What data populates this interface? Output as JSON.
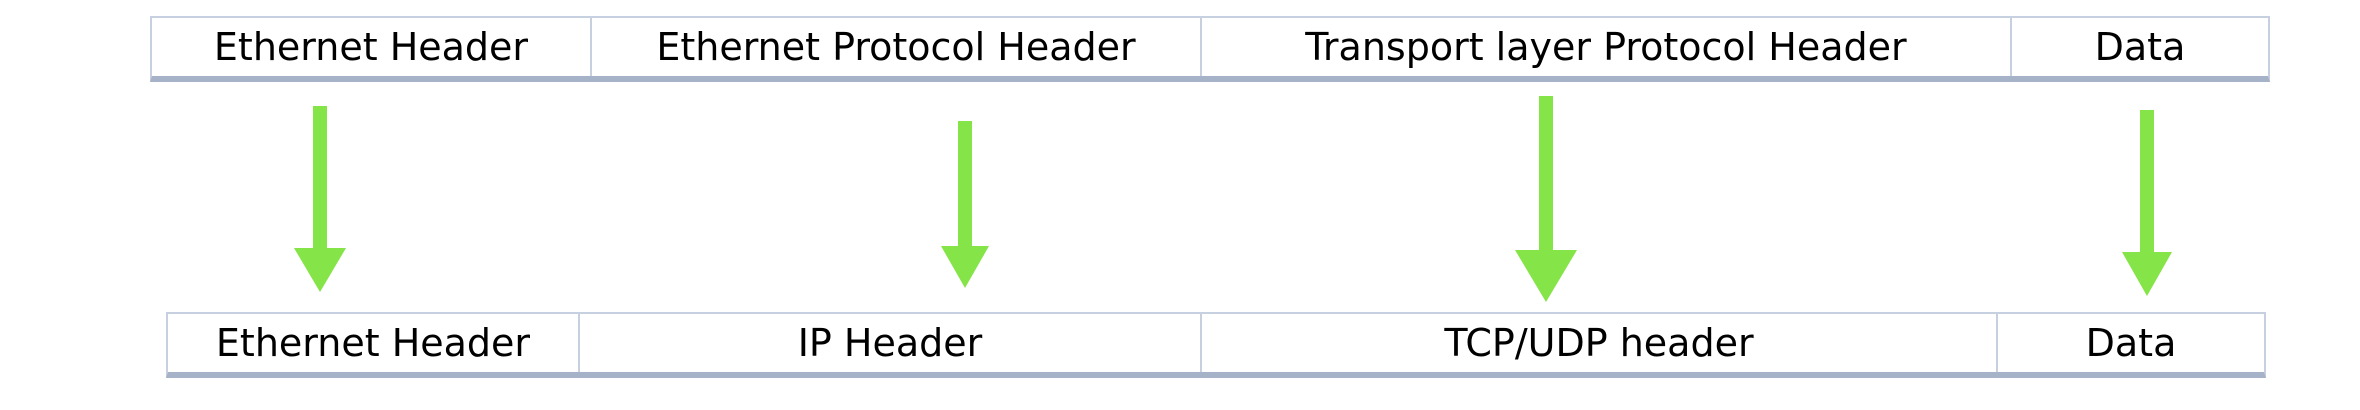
{
  "top_row": {
    "cells": [
      {
        "label": "Ethernet Header"
      },
      {
        "label": "Ethernet Protocol Header"
      },
      {
        "label": "Transport layer Protocol Header"
      },
      {
        "label": "Data"
      }
    ]
  },
  "bottom_row": {
    "cells": [
      {
        "label": "Ethernet Header"
      },
      {
        "label": "IP Header"
      },
      {
        "label": "TCP/UDP header"
      },
      {
        "label": "Data"
      }
    ]
  },
  "colors": {
    "arrow": "#84e448",
    "cell_border": "#c6d0e0",
    "row_underline": "#a6b2c8",
    "text": "#000000"
  }
}
